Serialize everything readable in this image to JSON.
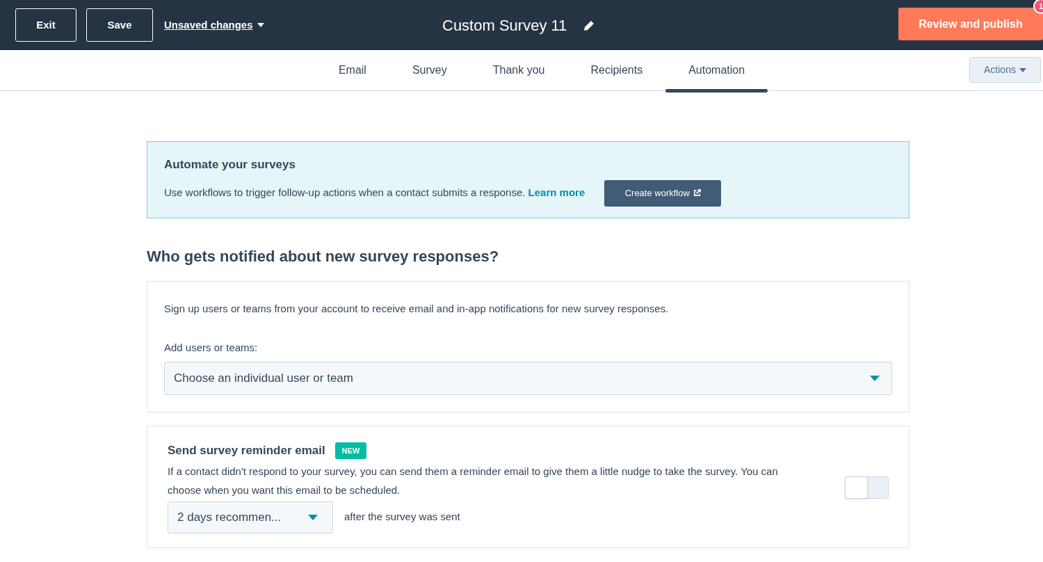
{
  "header": {
    "buttons": [
      "Exit",
      "Save"
    ],
    "unsaved": "Unsaved changes",
    "title": "Custom Survey 11",
    "publish": "Review and publish",
    "badge": "1"
  },
  "tabs": [
    {
      "label": "Email",
      "selected": false
    },
    {
      "label": "Survey",
      "selected": false
    },
    {
      "label": "Thank you",
      "selected": false
    },
    {
      "label": "Recipients",
      "selected": false
    },
    {
      "label": "Automation",
      "selected": true
    }
  ],
  "actions": "Actions",
  "banner": {
    "title": "Automate your surveys",
    "text": "Use workflows to trigger follow-up actions when a contact submits a response.",
    "link": "Learn more",
    "button": "Create workflow"
  },
  "notify": {
    "heading": "Who gets notified about new survey responses?",
    "text": "Sign up users or teams from your account to receive email and in-app notifications for new survey responses.",
    "label": "Add users or teams:",
    "placeholder": "Choose an individual user or team"
  },
  "reminder": {
    "title": "Send survey reminder email",
    "badge": "NEW",
    "text": "If a contact didn't respond to your survey, you can send them a reminder email to give them a little nudge to take the survey. You can choose when you want this email to be scheduled.",
    "select": "2 days recommen...",
    "after": "after the survey was sent",
    "on": false
  }
}
